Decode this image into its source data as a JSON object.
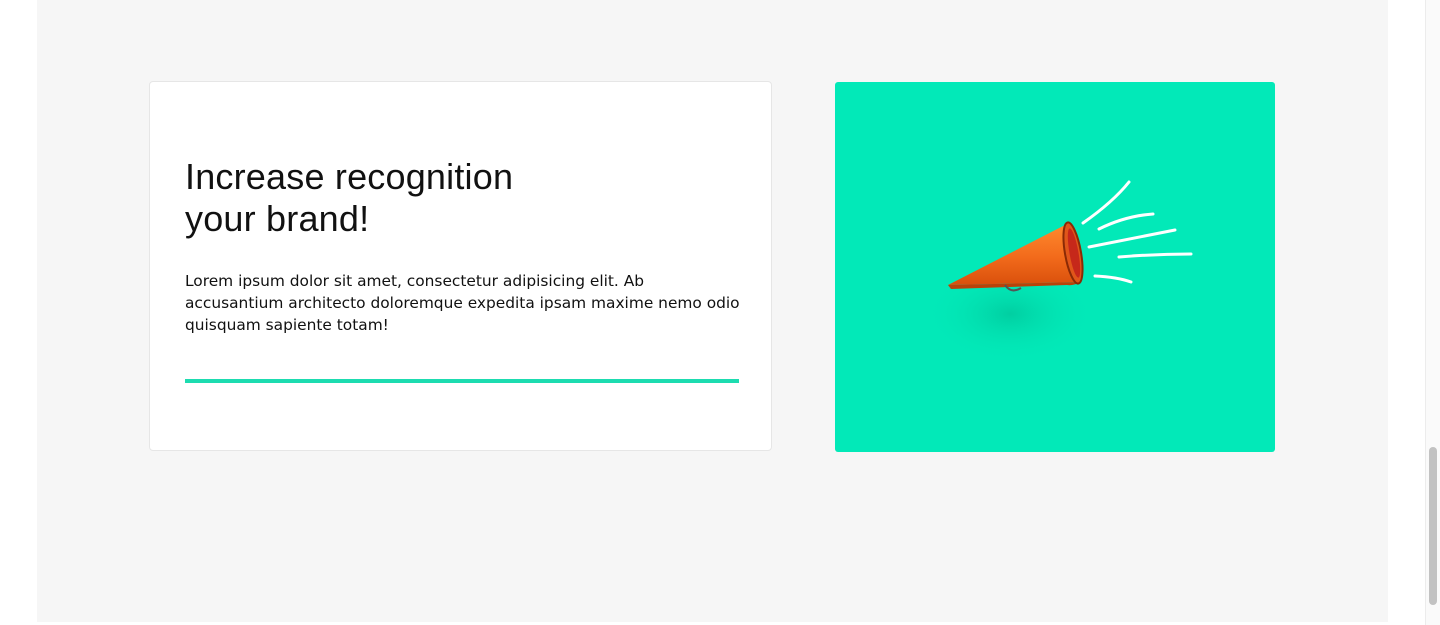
{
  "card": {
    "title_line1": "Increase recognition",
    "title_line2": "your brand!",
    "body": "Lorem ipsum dolor sit amet, consectetur adipisicing elit. Ab accusantium architecto doloremque expedita ipsam maxime nemo odio quisquam sapiente totam!"
  },
  "image": {
    "icon": "megaphone-icon"
  },
  "colors": {
    "section_background": "#f6f6f6",
    "accent": "#1ddcb0",
    "image_background": "#02e9b8",
    "megaphone": "#f26a1b"
  }
}
